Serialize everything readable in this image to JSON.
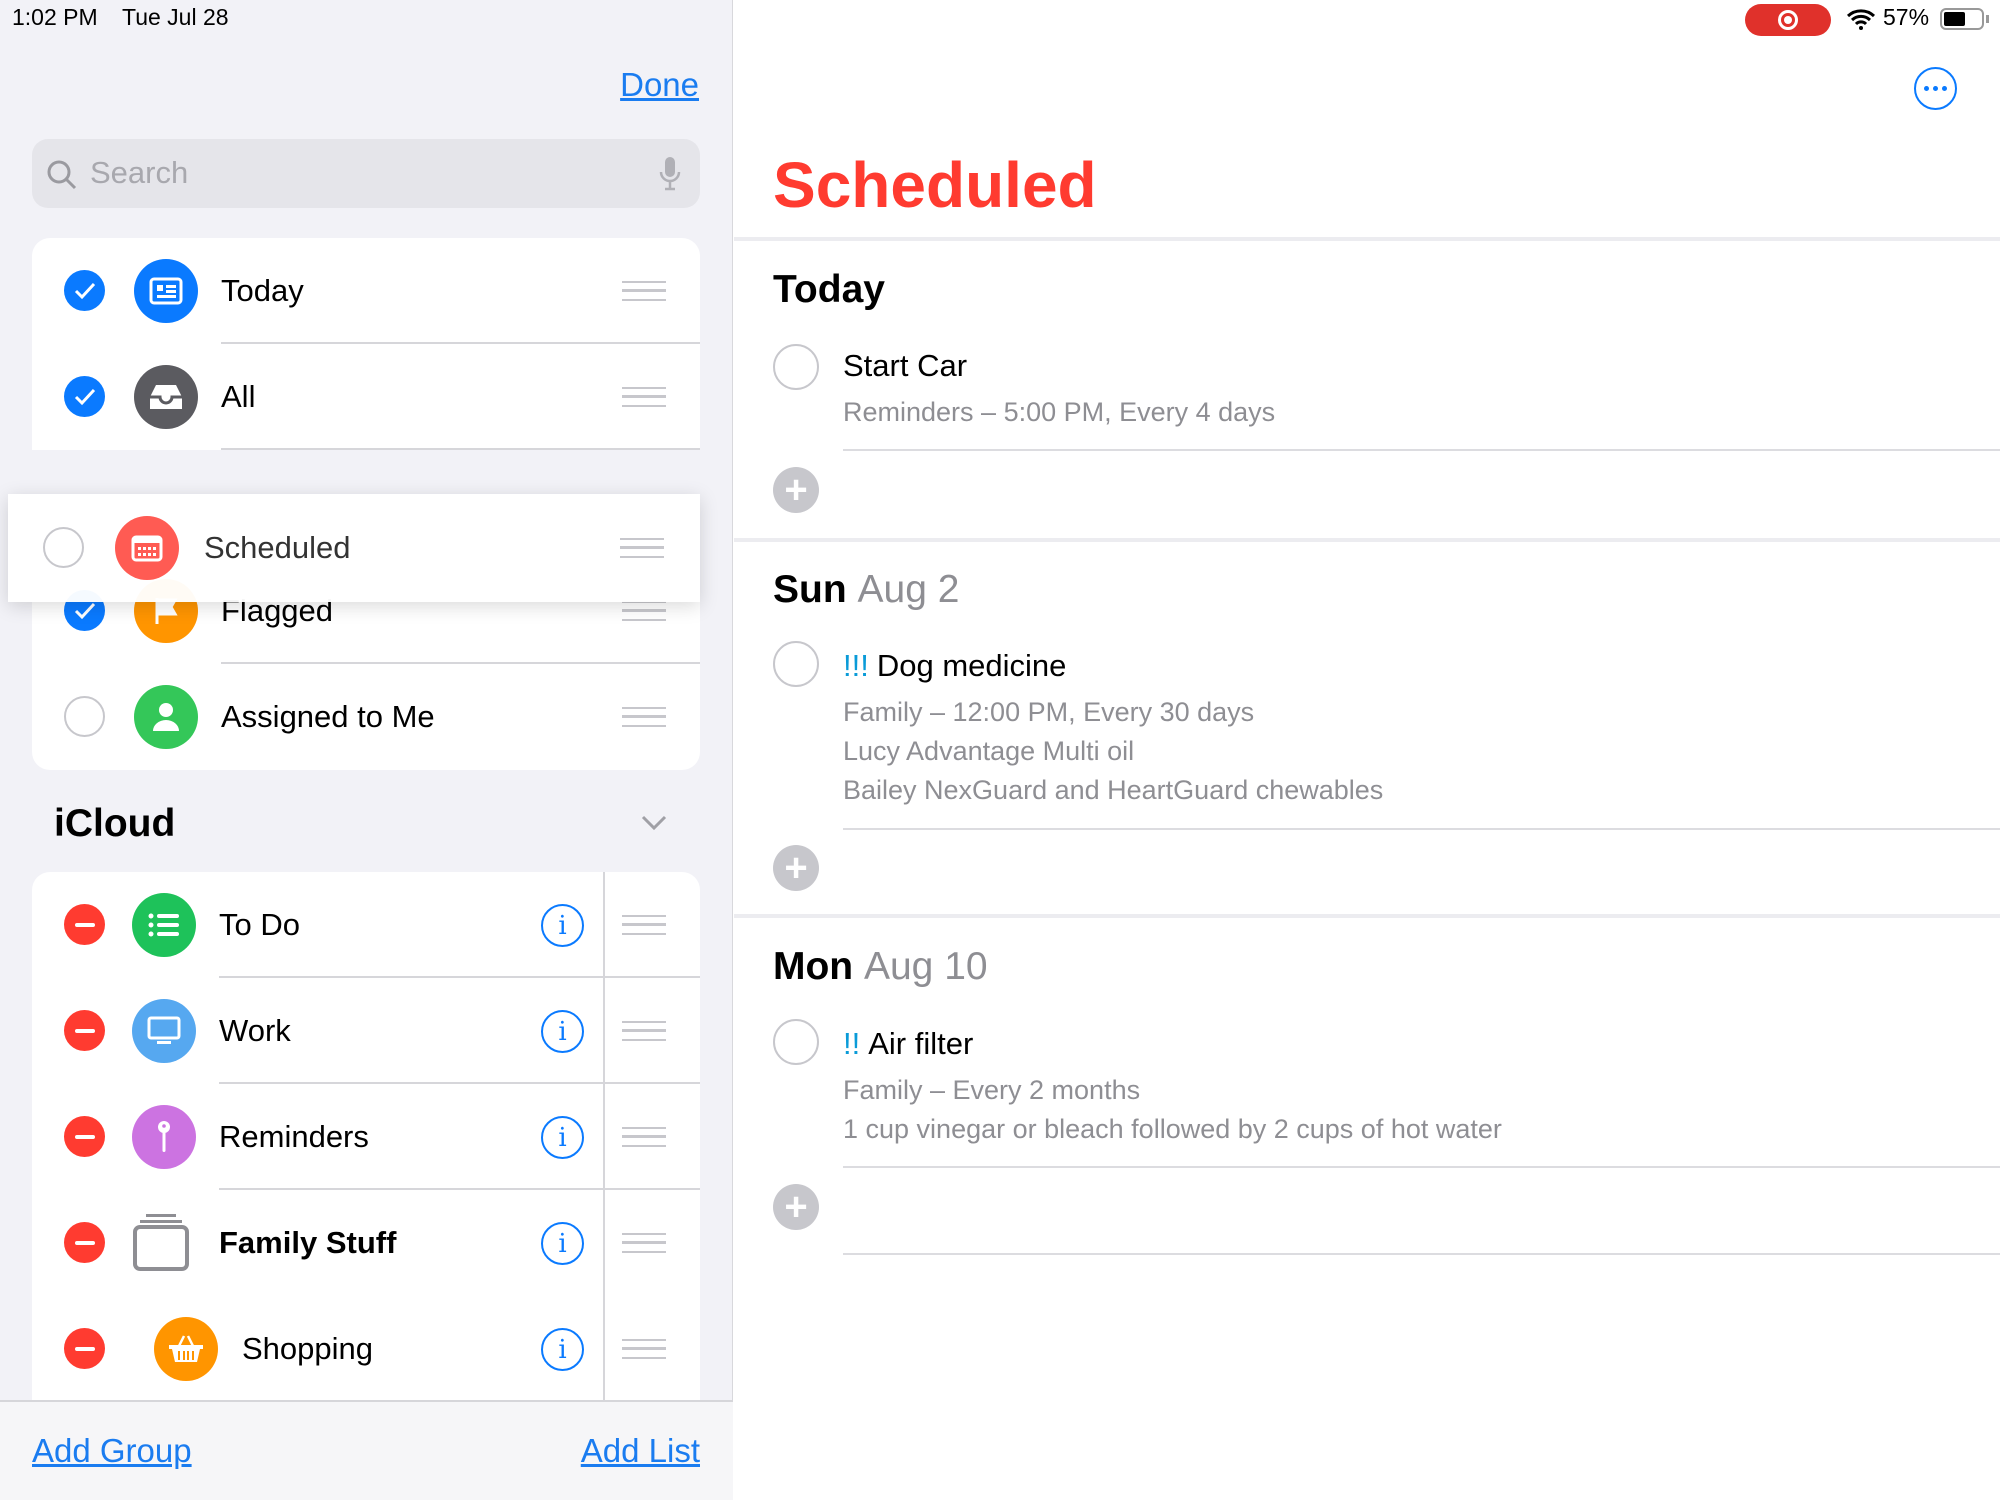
{
  "status_bar": {
    "time": "1:02 PM",
    "date": "Tue Jul 28",
    "battery": "57%",
    "battery_level": 0.57
  },
  "sidebar": {
    "done_label": "Done",
    "search": {
      "placeholder": "Search"
    },
    "smart_lists": [
      {
        "label": "Today",
        "checked": true,
        "icon": "calendar-card-icon",
        "color": "#0a7aff"
      },
      {
        "label": "All",
        "checked": true,
        "icon": "tray-icon",
        "color": "#5b5b60"
      },
      {
        "label": "Flagged",
        "checked": true,
        "icon": "flag-icon",
        "color": "#ff9500"
      },
      {
        "label": "Assigned to Me",
        "checked": false,
        "icon": "person-icon",
        "color": "#34c759"
      }
    ],
    "dragging_item": {
      "label": "Scheduled",
      "checked": false,
      "icon": "calendar-icon",
      "color": "#ff5b53"
    },
    "group_header": "iCloud",
    "lists": [
      {
        "label": "To Do",
        "icon": "list-icon",
        "color": "#1ec25a"
      },
      {
        "label": "Work",
        "icon": "monitor-icon",
        "color": "#56a8f0"
      },
      {
        "label": "Reminders",
        "icon": "pin-icon",
        "color": "#cc73e1"
      },
      {
        "label": "Family Stuff",
        "icon": "group-folder-icon",
        "color": "#8e8e93"
      },
      {
        "label": "Shopping",
        "icon": "basket-icon",
        "color": "#ff9500"
      }
    ],
    "add_group_label": "Add Group",
    "add_list_label": "Add List"
  },
  "main": {
    "title": "Scheduled",
    "title_color": "#ff3b30",
    "sections": [
      {
        "day": "Today",
        "date": "",
        "items": [
          {
            "priority": "",
            "title": "Start Car",
            "details": [
              "Reminders – 5:00 PM, Every 4 days"
            ]
          }
        ]
      },
      {
        "day": "Sun",
        "date": "Aug 2",
        "items": [
          {
            "priority": "!!!",
            "title": "Dog medicine",
            "details": [
              "Family – 12:00 PM, Every 30 days",
              "Lucy Advantage Multi oil",
              "Bailey NexGuard and HeartGuard chewables"
            ]
          }
        ]
      },
      {
        "day": "Mon",
        "date": "Aug 10",
        "items": [
          {
            "priority": "!!",
            "title": "Air filter",
            "details": [
              "Family – Every 2 months",
              "1 cup vinegar or bleach followed by 2 cups of hot water"
            ]
          }
        ]
      }
    ]
  }
}
